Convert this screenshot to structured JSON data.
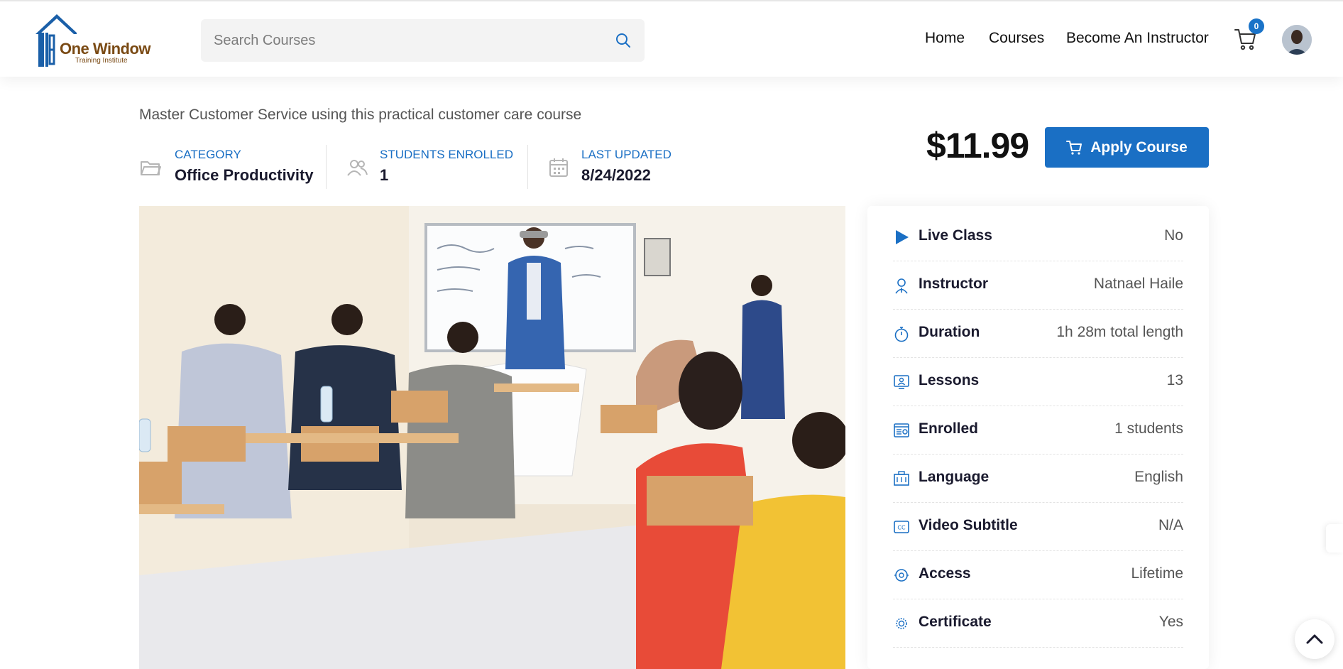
{
  "header": {
    "logo": {
      "title": "One Window",
      "subtitle": "Training Institute"
    },
    "search": {
      "placeholder": "Search Courses",
      "value": ""
    },
    "nav": {
      "home": "Home",
      "courses": "Courses",
      "become_instructor": "Become An Instructor"
    },
    "cart_count": "0"
  },
  "course": {
    "subtitle": "Master Customer Service using this practical customer care course",
    "meta": {
      "category_label": "CATEGORY",
      "category_value": "Office Productivity",
      "students_label": "STUDENTS ENROLLED",
      "students_value": "1",
      "updated_label": "LAST UPDATED",
      "updated_value": "8/24/2022"
    },
    "price": "$11.99",
    "apply_label": "Apply Course"
  },
  "details": [
    {
      "icon": "play-icon",
      "label": "Live Class",
      "value": "No"
    },
    {
      "icon": "instructor-icon",
      "label": "Instructor",
      "value": "Natnael Haile"
    },
    {
      "icon": "stopwatch-icon",
      "label": "Duration",
      "value": "1h 28m total length"
    },
    {
      "icon": "lessons-icon",
      "label": "Lessons",
      "value": "13"
    },
    {
      "icon": "enrolled-icon",
      "label": "Enrolled",
      "value": "1 students"
    },
    {
      "icon": "language-icon",
      "label": "Language",
      "value": "English"
    },
    {
      "icon": "subtitle-cc-icon",
      "label": "Video Subtitle",
      "value": "N/A"
    },
    {
      "icon": "access-icon",
      "label": "Access",
      "value": "Lifetime"
    },
    {
      "icon": "certificate-icon",
      "label": "Certificate",
      "value": "Yes"
    }
  ],
  "colors": {
    "accent": "#1a6fc4",
    "badge": "#1a73c8",
    "logo_brown": "#7a4a14"
  }
}
